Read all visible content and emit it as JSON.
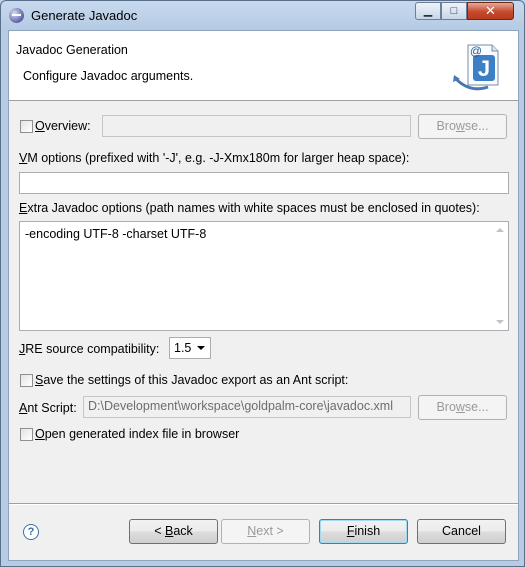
{
  "window": {
    "title": "Generate Javadoc",
    "buttons": {
      "minimize": "▁",
      "maximize": "□",
      "close": "✕"
    }
  },
  "header": {
    "title": "Javadoc Generation",
    "message": "Configure Javadoc arguments.",
    "icon": "javadoc-wizard-icon",
    "icon_letter": "J",
    "icon_at": "@"
  },
  "overview": {
    "label_u": "O",
    "label_rest": "verview:",
    "checked": false,
    "value": "",
    "browse_u": "w",
    "browse_before": "Bro",
    "browse_after": "se..."
  },
  "vm_options": {
    "label_u": "V",
    "label_rest": "M options (prefixed with '-J', e.g. -J-Xmx180m for larger heap space):",
    "value": ""
  },
  "extra_options": {
    "label_u": "E",
    "label_rest": "xtra Javadoc options (path names with white spaces must be enclosed in quotes):",
    "value": "-encoding UTF-8 -charset UTF-8"
  },
  "jre": {
    "label_u": "J",
    "label_rest": "RE source compatibility:",
    "selected": "1.5"
  },
  "ant": {
    "save_u": "S",
    "save_rest": "ave the settings of this Javadoc export as an Ant script:",
    "save_checked": false,
    "script_u": "A",
    "script_rest": "nt Script:",
    "script_value": "D:\\Development\\workspace\\goldpalm-core\\javadoc.xml",
    "browse_u": "w",
    "browse_before": "Bro",
    "browse_after": "se..."
  },
  "open_index": {
    "label_u": "O",
    "label_rest": "pen generated index file in browser",
    "checked": false
  },
  "footer": {
    "help": "?",
    "back_prefix": "< ",
    "back_u": "B",
    "back_rest": "ack",
    "next_u": "N",
    "next_rest": "ext >",
    "finish_u": "F",
    "finish_rest": "inish",
    "cancel": "Cancel"
  }
}
